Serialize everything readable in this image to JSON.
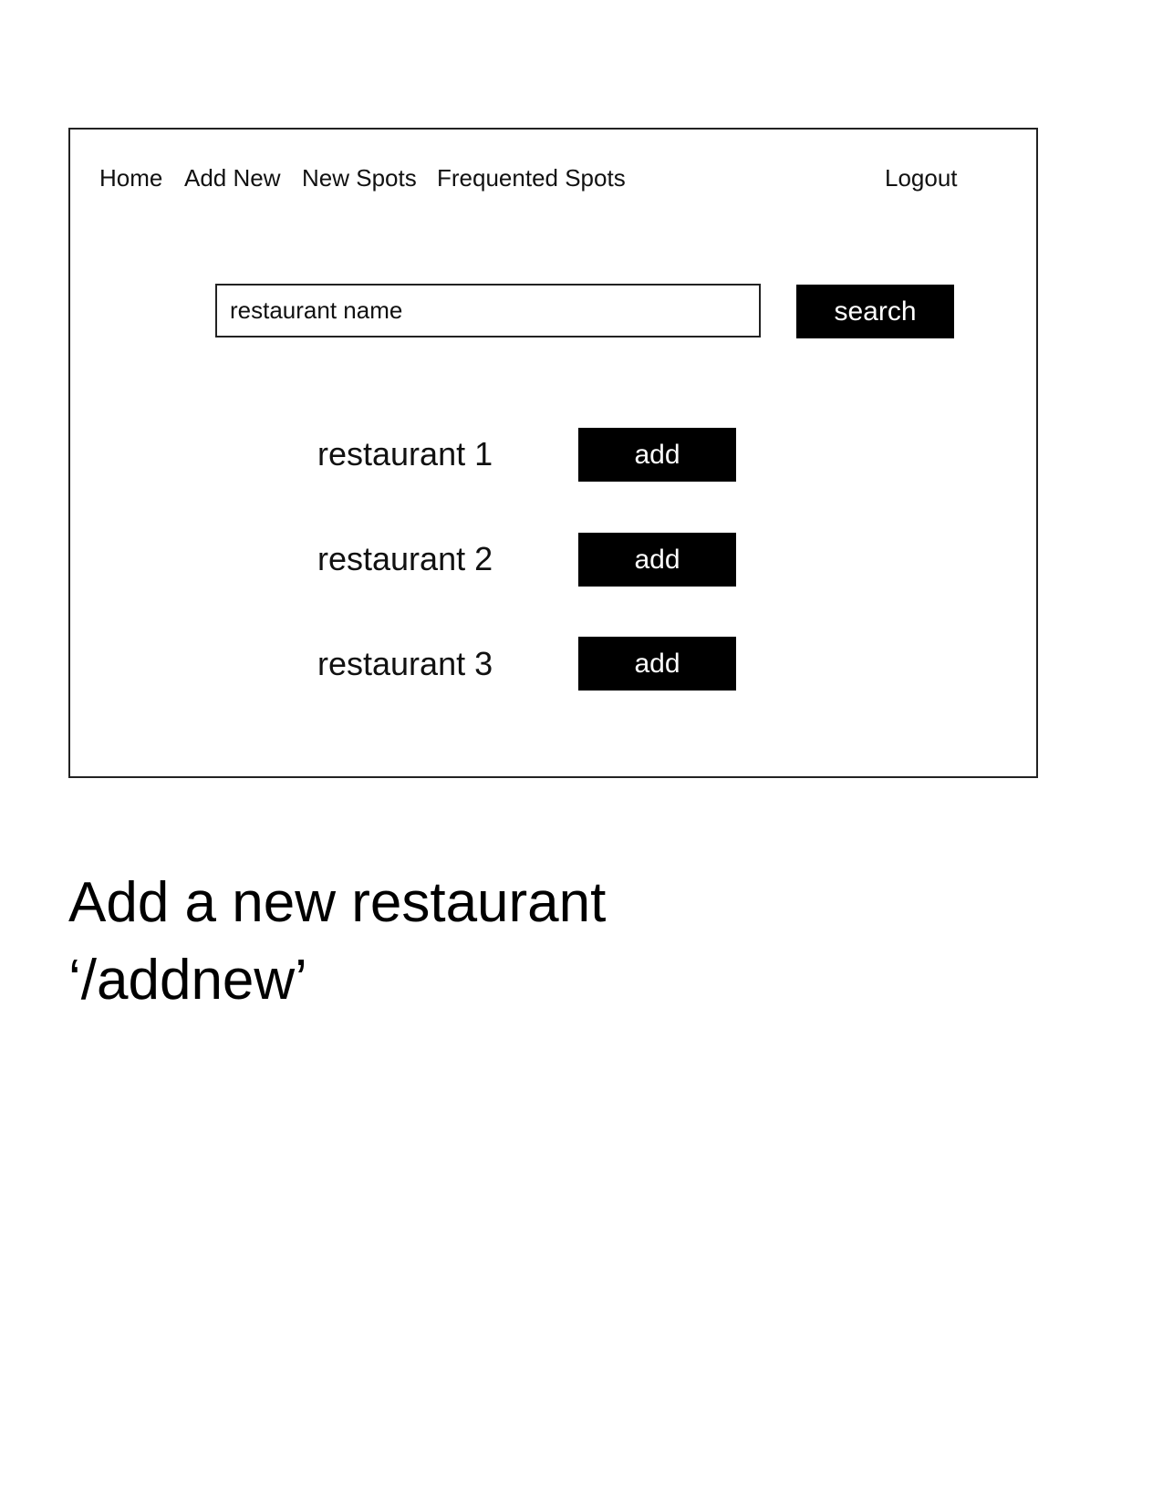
{
  "nav": {
    "items": [
      {
        "label": "Home"
      },
      {
        "label": "Add New"
      },
      {
        "label": "New Spots"
      },
      {
        "label": "Frequented Spots"
      }
    ],
    "logout_label": "Logout"
  },
  "search": {
    "placeholder": "restaurant name",
    "button_label": "search"
  },
  "results": [
    {
      "name": "restaurant 1",
      "action_label": "add"
    },
    {
      "name": "restaurant 2",
      "action_label": "add"
    },
    {
      "name": "restaurant 3",
      "action_label": "add"
    }
  ],
  "caption": {
    "title": "Add a new restaurant",
    "route": "‘/addnew’"
  },
  "colors": {
    "button_background": "#000000",
    "button_text": "#ffffff",
    "border": "#222222"
  }
}
